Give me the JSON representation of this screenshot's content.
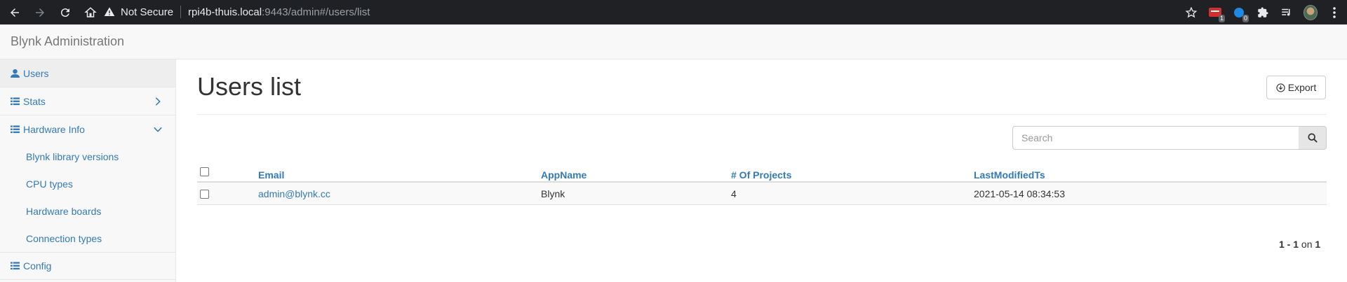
{
  "browser": {
    "security_label": "Not Secure",
    "url_host": "rpi4b-thuis.local",
    "url_rest": ":9443/admin#/users/list",
    "ext_badges": [
      "1",
      "0"
    ]
  },
  "app": {
    "title": "Blynk Administration"
  },
  "sidebar": {
    "items": [
      {
        "label": "Users",
        "icon": "user-icon"
      },
      {
        "label": "Stats",
        "icon": "list-icon"
      },
      {
        "label": "Hardware Info",
        "icon": "list-icon"
      },
      {
        "label": "Config",
        "icon": "list-icon"
      }
    ],
    "hardware_sub": [
      "Blynk library versions",
      "CPU types",
      "Hardware boards",
      "Connection types"
    ]
  },
  "main": {
    "title": "Users list",
    "export_label": "Export",
    "search_placeholder": "Search"
  },
  "table": {
    "columns": [
      "Email",
      "AppName",
      "# Of Projects",
      "LastModifiedTs"
    ],
    "rows": [
      [
        "admin@blynk.cc",
        "Blynk",
        "4",
        "2021-05-14 08:34:53"
      ]
    ]
  },
  "pagination": {
    "from": "1",
    "dash": " - ",
    "to": "1",
    "on": " on ",
    "total": "1"
  },
  "colors": {
    "link": "#337ab7",
    "browser_bg": "#202124"
  }
}
